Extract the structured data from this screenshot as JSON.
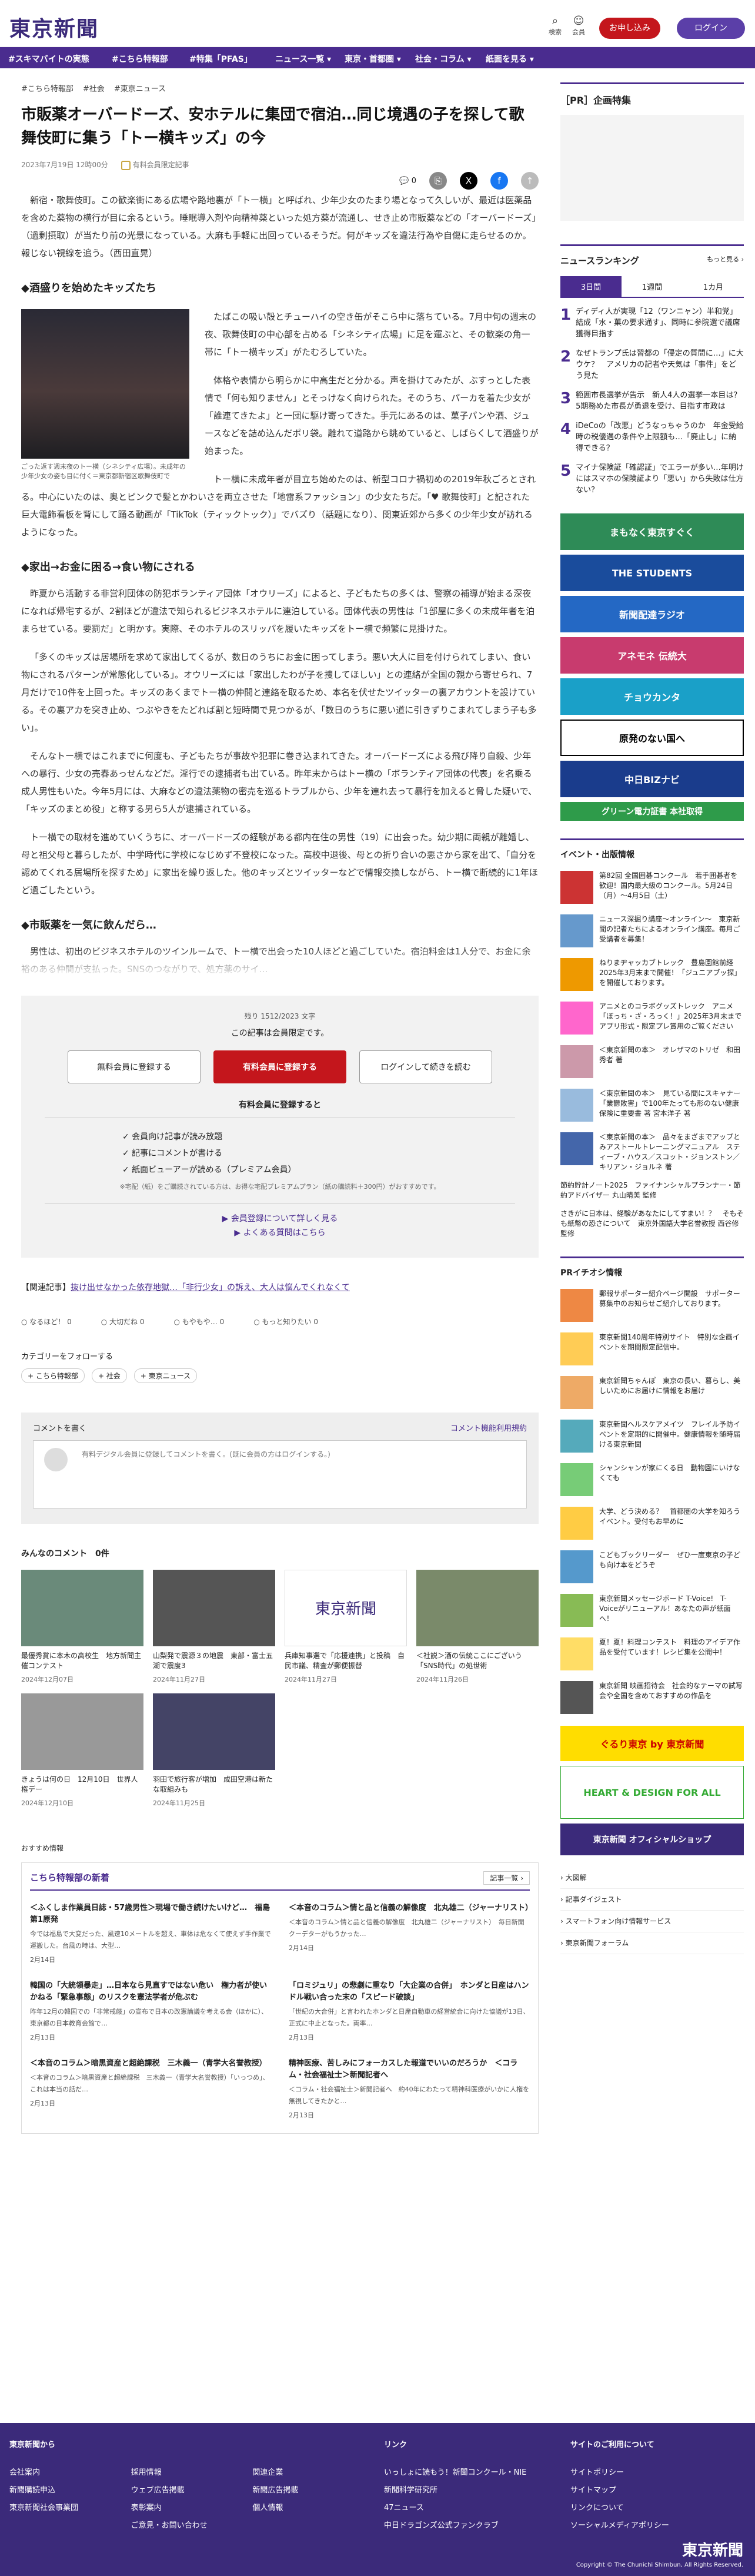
{
  "header": {
    "logo": "東京新聞",
    "search": "検索",
    "mypage": "会員",
    "subscribe": "お申し込み",
    "login": "ログイン"
  },
  "nav": [
    "#スキマバイトの実態",
    "#こちら特報部",
    "#特集「PFAS」",
    "ニュース一覧 ▾",
    "東京・首都圏 ▾",
    "社会・コラム ▾",
    "紙面を見る ▾"
  ],
  "article": {
    "crumbs": [
      "#こちら特報部",
      "#社会",
      "#東京ニュース"
    ],
    "title": "市販薬オーバードーズ、安ホテルに集団で宿泊…同じ境遇の子を探して歌舞伎町に集う「トー横キッズ」の今",
    "date": "2023年7月19日 12時00分",
    "badge": "有料会員限定記事",
    "share_count": "0",
    "p1": "新宿・歌舞伎町。この歓楽街にある広場や路地裏が「トー横」と呼ばれ、少年少女のたまり場となって久しいが、最近は医薬品を含めた薬物の横行が目に余るという。睡眠導入剤や向精神薬といった処方薬が流通し、せき止め市販薬などの「オーバードーズ」（過剰摂取）が当たり前の光景になっている。大麻も手軽に出回っているそうだ。何がキッズを違法行為や自傷に走らせるのか。報じない視線を追う。（西田直晃）",
    "h_a": "◆酒盛りを始めたキッズたち",
    "caption": "ごった返す週末夜のトー横（シネシティ広場）。未成年の少年少女の姿も目に付く＝東京都新宿区歌舞伎町で",
    "p2": "たばこの吸い殻とチューハイの空き缶がそこら中に落ちている。7月中旬の週末の夜、歌舞伎町の中心部を占める「シネシティ広場」に足を運ぶと、その歓楽の角一帯に「トー横キッズ」がたむろしていた。",
    "p3": "体格や表情から明らかに中高生だと分かる。声を掛けてみたが、ぶすっとした表情で「何も知りません」とそっけなく向けられた。そのうち、パーカを着た少女が「誰連てきたよ」と一団に駆け寄ってきた。手元にあるのは、菓子パンや酒、ジュースなどを詰め込んだポリ袋。離れて道路から眺めていると、しばらくして酒盛りが始まった。",
    "p4": "トー横に未成年者が目立ち始めたのは、新型コロナ禍初めの2019年秋ごろとされる。中心にいたのは、奥とピンクで髪とかわいさを両立させた「地雷系ファッション」の少女たちだ。「♥ 歌舞伎町」と記された巨大電飾看板を背にして踊る動画が「TikTok（ティックトック）」でバズり（話題になり）、関東近郊から多くの少年少女が訪れるようになった。",
    "h_b": "◆家出→お金に困る→食い物にされる",
    "p5": "昨夏から活動する非営利団体の防犯ボランティア団体「オウリーズ」によると、子どもたちの多くは、警察の補導が始まる深夜になれば帰宅するが、2割ほどが違法で知られるビジネスホテルに連泊している。団体代表の男性は「1部屋に多くの未成年者を泊まらせている。要罰だ」と明かす。実際、そのホテルのスリッパを履いたキッズをトー横で頻繁に見掛けた。",
    "p6": "「多くのキッズは居場所を求めて家出してくるが、数日のうちにお金に困ってしまう。悪い大人に目を付けられてしまい、食い物にされるパターンが常態化している」。オウリーズには「家出したわが子を捜してほしい」との連絡が全国の親から寄せられ、7月だけで10件を上回った。キッズのあくまでトー横の仲間と連絡を取るため、本名を伏せたツイッターの裏アカウントを設けている。その裏アカを突き止め、つぶやきをたどれば割と短時間で見つかるが、「数日のうちに悪い道に引きずりこまれてしまう子も多い」。",
    "p7": "そんなトー横ではこれまでに何度も、子どもたちが事故や犯罪に巻き込まれてきた。オーバードーズによる飛び降り自殺、少年への暴行、少女の売春あっせんなどだ。淫行での逮捕者も出ている。昨年末からはトー横の「ボランティア団体の代表」を名乗る成人男性もいた。今年5月には、大麻などの違法薬物の密売を巡るトラブルから、少年を連れ去って暴行を加えると脅した疑いで、「キッズのまとめ役」と称する男ら5人が逮捕されている。",
    "p8": "トー横での取材を進めていくうちに、オーバードーズの経験がある都内在住の男性（19）に出会った。幼少期に両親が離婚し、母と祖父母と暮らしたが、中学時代に学校になじめず不登校になった。高校中退後、母との折り合いの悪さから家を出て、「自分を認めてくれる居場所を探すため」に家出を繰り返した。他のキッズとツイッターなどで情報交換しながら、トー横で断続的に1年ほど過ごしたという。",
    "h_c": "◆市販薬を一気に飲んだら…",
    "p9": "男性は、初出のビジネスホテルのツインルームで、トー横で出会った10人ほどと過ごしていた。宿泊料金は1人分で、お金に余裕のある仲間が支払った。SNSのつながりで、処方薬のサイ…"
  },
  "paywall": {
    "remaining": "残り 1512/2023 文字",
    "notice": "この記事は会員限定です。",
    "btn_free": "無料会員に登録する",
    "btn_paid": "有料会員に登録する",
    "btn_login": "ログインして続きを読む",
    "benefits_title": "有料会員に登録すると",
    "benefits": [
      "✓ 会員向け記事が読み放題",
      "✓ 記事にコメントが書ける",
      "✓ 紙面ビューアーが読める（プレミアム会員）"
    ],
    "note": "※宅配（紙）をご購読されている方は、お得な宅配プレミアムプラン（紙の購読料＋300円）がおすすめです。",
    "link1": "▶ 会員登録について詳しく見る",
    "link2": "▶ よくある質問はこちら"
  },
  "related": {
    "label": "【関連記事】",
    "text": "抜け出せなかった依存地獄…「非行少女」の訴え、大人は悩んでくれなくて"
  },
  "reactions": [
    "なるほど！ 0",
    "大切だね 0",
    "もやもや… 0",
    "もっと知りたい 0"
  ],
  "follow": {
    "title": "カテゴリーをフォローする",
    "tags": [
      "+ こちら特報部",
      "+ 社会",
      "+ 東京ニュース"
    ]
  },
  "comment": {
    "title": "コメントを書く",
    "rules": "コメント機能利用規約",
    "placeholder": "有料デジタル会員に登録してコメントを書く。(既に会員の方はログインする。)",
    "list_title": "みんなのコメント　0件"
  },
  "cards": [
    {
      "title": "最優秀賞に本木の高校生　地方新聞主催コンテスト",
      "date": "2024年12月07日"
    },
    {
      "title": "山梨発で震源３の地震　東部・富士五湖で震度3",
      "date": "2024年11月27日"
    },
    {
      "title": "兵庫知事選で「応援連携」と投稿　自民市議、精査が郵便振替",
      "date": "2024年11月27日"
    },
    {
      "title": "＜社説＞酒の伝統ここにございう「SNS時代」の処世術",
      "date": "2024年11月26日"
    },
    {
      "title": "きょうは何の日　12月10日　世界人権デー",
      "date": "2024年12月10日"
    },
    {
      "title": "羽田で旅行客が増加　成田空港は新たな取組みも",
      "date": "2024年11月25日"
    }
  ],
  "recommend": {
    "label": "おすすめ情報",
    "box_title": "こちら特報部の新着",
    "more": "記事一覧 ›",
    "items": [
      {
        "title": "＜ふくしま作業員日誌・57歳男性＞現場で働き続けたいけど…　福島第1原発",
        "snip": "今では福島で大変だった、風速10メートルを超え、車体は危なくて使えず手作業で運搬した。台風の時は、大型…",
        "date": "2月14日"
      },
      {
        "title": "＜本音のコラム＞情と品と信義の解像度　北丸雄二（ジャーナリスト）",
        "snip": "＜本音のコラム＞情と品と信義の解像度　北丸雄二（ジャーナリスト）　毎日新聞クーデターがもうかった…",
        "date": "2月14日"
      },
      {
        "title": "韓国の「大統領暴走」…日本なら見直すではない危い　権力者が使いかねる「緊急事態」のリスクを憲法学者が危ぶむ",
        "snip": "昨年12月の韓国での「非常戒厳」の宣布で日本の改憲論議を考える会（ほかに）、東京都の日本教育会館で…",
        "date": "2月13日"
      },
      {
        "title": "「ロミジュリ」の悲劇に重なり「大企業の合併」　ホンダと日産はハンドル戦い合った末の「スピード破談」",
        "snip": "「世紀の大合併」と言われたホンダと日産自動車の経営統合に向けた協議が13日、正式に中止となった。両率…",
        "date": "2月13日"
      },
      {
        "title": "＜本音のコラム＞暗黒資産と超絶課税　三木義一（青学大名誉教授）",
        "snip": "＜本音のコラム＞暗黒資産と超絶課税　三木義一（青学大名誉教授）「いっつめ」、これは本当の話だ…",
        "date": "2月13日"
      },
      {
        "title": "精神医療、苦しみにフォーカスした報道でいいのだろうか　＜コラム・社会福祉士＞新聞記者へ",
        "snip": "＜コラム・社会福祉士＞新聞記者へ　約40年にわたって精神科医療がいかに人権を無視してきたかと…",
        "date": "2月13日"
      }
    ]
  },
  "sidebar": {
    "pr_title": "［PR］企画特集",
    "ranking_title": "ニュースランキング",
    "ranking_more": "もっと見る ›",
    "tabs": [
      "3日間",
      "1週間",
      "1カ月"
    ],
    "ranking": [
      {
        "n": "1",
        "t": "ディディ人が実現「12（ワンニャン）半和党」結成「水・菓の要求通す」、同時に参院選で議席獲得目指す"
      },
      {
        "n": "2",
        "t": "なぜトランプ氏は習都の「侵定の質問に…」に大ウケ？　アメリカの記者や天気は「事件」をどう見た"
      },
      {
        "n": "3",
        "t": "範囲市長選挙が告示　新人4人の選挙一本目は？　5期務めた市長が勇退を受け、目指す市政は"
      },
      {
        "n": "4",
        "t": "iDeCoの「改悪」どうなっちゃうのか　年金受給時の税優遇の条件や上限額も…「廃止し」に納得できる？"
      },
      {
        "n": "5",
        "t": "マイナ保険証「確認証」でエラーが多い…年明けにはスマホの保険証より「悪い」から失敗は仕方ない？"
      }
    ],
    "banners": [
      "まもなく東京すぐく",
      "THE STUDENTS",
      "新聞配達ラジオ",
      "アネモネ 伝統大",
      "チョウカンタ",
      "原発のない国へ",
      "中日BIZナビ",
      "グリーン電力証書 本社取得"
    ],
    "events_title": "イベント・出版情報",
    "events": [
      "第82回 全国囲碁コンクール　若手囲碁者を歓迎！国内最大級のコンクール。5月24日（月）〜4月5日（土）",
      "ニュース深掘り講座〜オンライン〜　東京新聞の記者たちによるオンライン講座。毎月ご受講者を募集！",
      "ねりまヂャッカブトレック　豊島園館前経2025年3月末まで開催！「ジュニアブッ探」を開催しております。",
      "アニメとのコラボグッズトレック　アニメ「ぼっち・ざ・ろっく！」2025年3月末までアプリ形式・限定プレ賞用のご覧ください",
      "＜東京新聞の本＞　オレザマのトリゼ　和田秀者 著",
      "＜東京新聞の本＞　見ている間にスキャナー「業鬱敗害」で100年たっても形のない健康保険に重要書 著 宮本洋子 著",
      "＜東京新聞の本＞　品々をまざまでアップとみアストールトレーニングマニュアル　スティーブ・ハウス／スコット・ジョンストン／キリアン・ジョルネ 著"
    ],
    "book_note": "節約貯計ノート2025　ファイナンシャルプランナー・節約アドバイザー 丸山晴美 監修",
    "book_note2": "さきがに日本は、経験があなたにしてすまい！？　そもそも紙幣の恐さについて　東京外国語大学名誉教授 西谷修 監修",
    "pr_info_title": "PRイチオシ情報",
    "pr_info": [
      "郵報サポーター紹介ページ開設　サポーター募集中のお知らせご紹介しております。",
      "東京新聞140周年特別サイト　特別な企画イベントを期間限定配信中。",
      "東京新聞ちゃんぽ　東京の長い、暮らし、美しいためにお届けに情報をお届け",
      "東京新聞ヘルスケアメイツ　フレイル予防イベントを定期的に開催中。健康情報を随時届ける東京新聞",
      "シャンシャンが家にくる日　動物園にいけなくても",
      "大学、どう決める？　首都圏の大学を知ろうイベント。受付もお早めに",
      "こどもブックリーダー　ぜひ一度東京の子ども向け本をどうぞ",
      "東京新聞メッセージボード T-Voice!　T-Voiceがリニューアル！あなたの声が紙面へ！",
      "夏！夏！料理コンテスト　料理のアイデア作品を受付ています！レシピ集を公開中！",
      "東京新聞 映画招待会　社会的なテーマの試写会や全国を含めておすすめの作品を"
    ],
    "bottom_banners": [
      "ぐるり東京 by 東京新聞",
      "HEART & DESIGN FOR ALL",
      "東京新聞 オフィシャルショップ"
    ],
    "links": [
      "大図解",
      "記事ダイジェスト",
      "スマートフォン向け情報サービス",
      "東京新聞フォーラム"
    ]
  },
  "footer": {
    "col1_title": "東京新聞から",
    "col2_title": "リンク",
    "col3_title": "サイトのご利用について",
    "col1": [
      "会社案内",
      "新聞購読申込",
      "東京新聞社会事業団",
      "採用情報",
      "ウェブ広告掲載",
      "表彰案内",
      "ご意見・お問い合わせ",
      "関連企業",
      "新聞広告掲載",
      "個人情報"
    ],
    "col2": [
      "いっしょに読もう！新聞コンクール・NIE",
      "新聞科学研究所",
      "47ニュース",
      "中日ドラゴンズ公式ファンクラブ"
    ],
    "col3": [
      "サイトポリシー",
      "サイトマップ",
      "リンクについて",
      "ソーシャルメディアポリシー"
    ],
    "logo": "東京新聞",
    "copyright": "Copyright © The Chunichi Shimbun, All Rights Reserved."
  }
}
